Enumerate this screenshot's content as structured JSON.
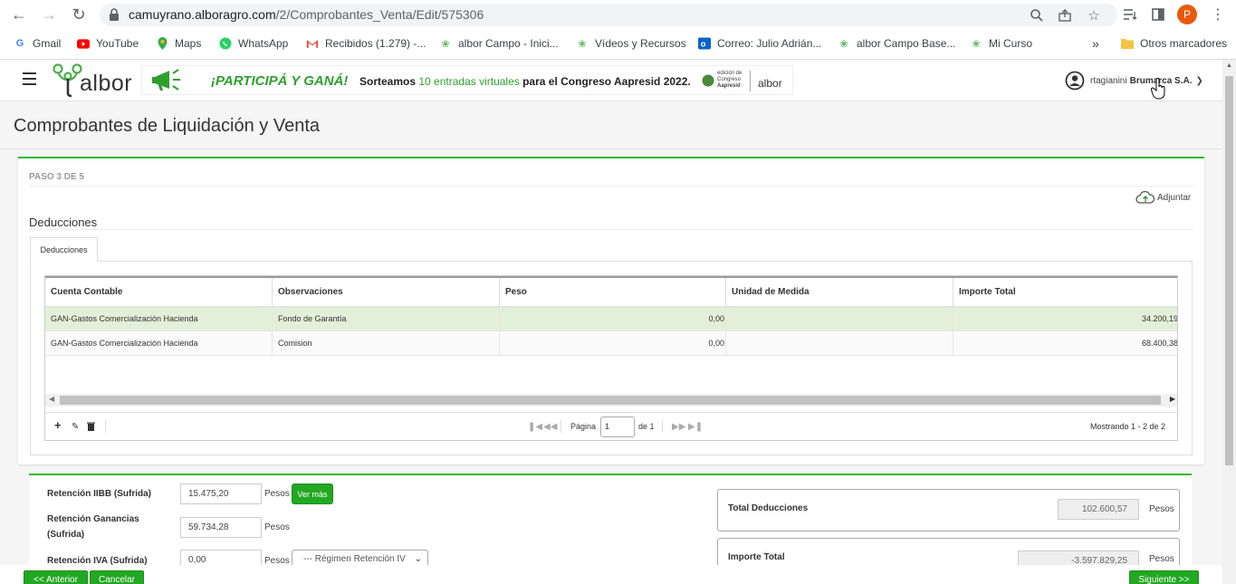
{
  "browser": {
    "url_host": "camuyrano.alboragro.com",
    "url_path": "/2/Comprobantes_Venta/Edit/575306",
    "profile_initial": "P",
    "bookmarks": [
      {
        "label": "Gmail",
        "icon": "google-icon"
      },
      {
        "label": "YouTube",
        "icon": "youtube-icon"
      },
      {
        "label": "Maps",
        "icon": "maps-icon"
      },
      {
        "label": "WhatsApp",
        "icon": "whatsapp-icon"
      },
      {
        "label": "Recibidos (1.279) -...",
        "icon": "gmail-icon"
      },
      {
        "label": "albor Campo - Inici...",
        "icon": "albor-icon"
      },
      {
        "label": "Vídeos y Recursos",
        "icon": "albor-icon"
      },
      {
        "label": "Correo: Julio Adrián...",
        "icon": "outlook-icon"
      },
      {
        "label": "albor Campo Base...",
        "icon": "albor-icon"
      },
      {
        "label": "Mi Curso",
        "icon": "albor-icon"
      }
    ],
    "more_bookmarks": "»",
    "other_bookmarks": "Otros marcadores"
  },
  "header": {
    "logo_text": "albor",
    "banner": {
      "promo": "¡PARTICIPÁ Y GANÁ!",
      "text_a": "Sorteamos ",
      "text_b": "10 entradas virtuales",
      "text_c": " para el Congreso Aapresid 2022.",
      "logo_a1": "edición de",
      "logo_a2": "Congreso",
      "logo_a3": "Aapresid",
      "logo_b": "albor"
    },
    "user_name": "rtagianini",
    "company": "Brumarca S.A."
  },
  "page": {
    "title": "Comprobantes de Liquidación y Venta",
    "step": "PASO 3 DE 5",
    "attach": "Adjuntar",
    "section": "Deducciones",
    "tab": "Deducciones"
  },
  "grid": {
    "columns": [
      "Cuenta Contable",
      "Observaciones",
      "Peso",
      "Unidad de Medida",
      "Importe Total"
    ],
    "rows": [
      {
        "cuenta": "GAN-Gastos Comercialización Hacienda",
        "obs": "Fondo de Garantía",
        "peso": "0,00",
        "unidad": "",
        "importe": "34.200,19"
      },
      {
        "cuenta": "GAN-Gastos Comercialización Hacienda",
        "obs": "Comision",
        "peso": "0,00",
        "unidad": "",
        "importe": "68.400,38"
      }
    ],
    "pager": {
      "page_label": "Página",
      "page_value": "1",
      "of_label": "de 1",
      "showing": "Mostrando 1 - 2 de 2"
    }
  },
  "summary": {
    "ret_iibb_label": "Retención IIBB (Sufrida)",
    "ret_iibb_value": "15.475,20",
    "ret_gan_label_1": "Retención Ganancias",
    "ret_gan_label_2": "(Sufrida)",
    "ret_gan_value": "59.734,28",
    "ret_iva_label": "Retención IVA (Sufrida)",
    "ret_iva_value": "0,00",
    "regimen_placeholder": "--- Régimen Retención IV",
    "unit": "Pesos",
    "ver_mas": "Ver más",
    "total_ded_label": "Total Deducciones",
    "total_ded_value": "102.600,57",
    "importe_total_label": "Importe Total",
    "importe_total_value": "-3.597.829,25"
  },
  "footer": {
    "prev": "<< Anterior",
    "cancel": "Cancelar",
    "next": "Siguiente >>"
  },
  "colors": {
    "accent_green": "#22a822",
    "selected_row": "#e2f0d9",
    "profile": "#e8590c"
  }
}
